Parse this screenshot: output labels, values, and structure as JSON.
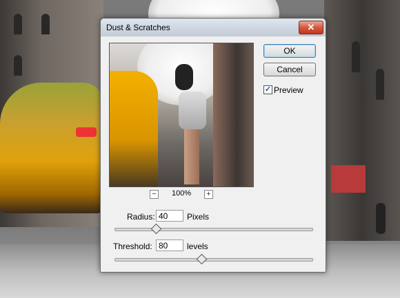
{
  "dialog": {
    "title": "Dust & Scratches",
    "close_label": "✕",
    "ok_label": "OK",
    "cancel_label": "Cancel",
    "preview_label": "Preview",
    "preview_checked": true,
    "zoom": {
      "minus": "−",
      "level": "100%",
      "plus": "+"
    },
    "radius": {
      "label": "Radius:",
      "value": "40",
      "unit": "Pixels",
      "slider_level": 0.21
    },
    "threshold": {
      "label": "Threshold:",
      "value": "80",
      "unit": "levels",
      "slider_level": 0.44
    }
  },
  "colors": {
    "titlebar": "#cfd8e2",
    "close_button": "#d7573d",
    "dialog_bg": "#f0f0f0",
    "default_button_border": "#3c7fb1"
  },
  "icons": {
    "close": "close-icon",
    "zoom_out": "minus-icon",
    "zoom_in": "plus-icon",
    "check": "checkmark-icon"
  }
}
